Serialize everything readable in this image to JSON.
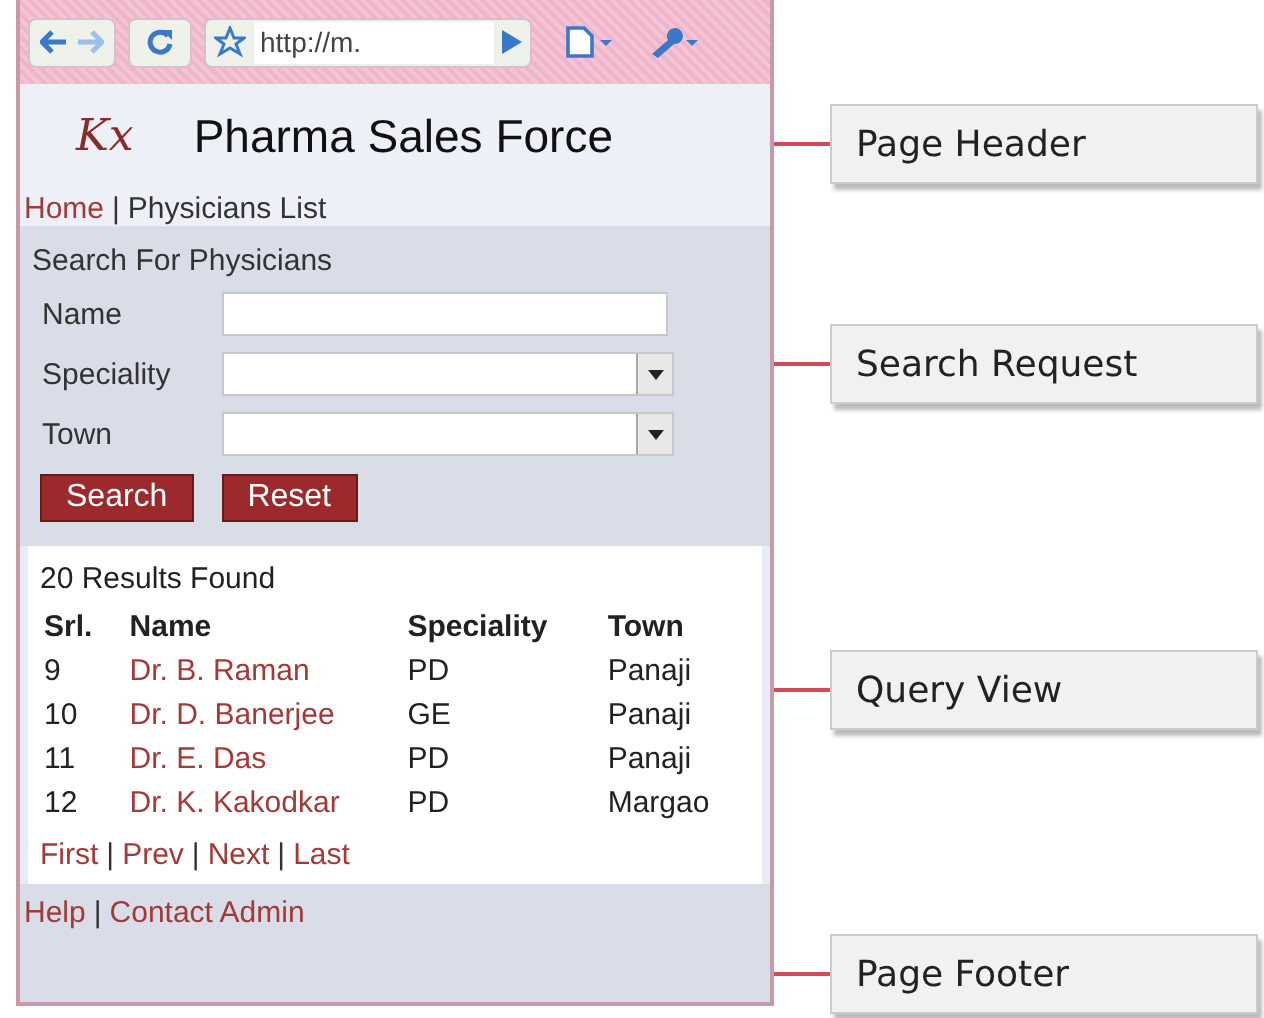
{
  "browser": {
    "address": "http://m."
  },
  "header": {
    "logo": "Kx",
    "title": "Pharma Sales Force"
  },
  "nav": [
    {
      "text": "Home",
      "kind": "link"
    },
    {
      "text": "|",
      "kind": "separator"
    },
    {
      "text": "Physicians List",
      "kind": "current"
    }
  ],
  "search": {
    "title": "Search For Physicians",
    "fields": [
      {
        "label": "Name",
        "kind": "text"
      },
      {
        "label": "Speciality",
        "kind": "select"
      },
      {
        "label": "Town",
        "kind": "select"
      }
    ],
    "buttons": [
      "Search",
      "Reset"
    ]
  },
  "results": {
    "count": "20 Results Found",
    "columns": [
      "Srl.",
      "Name",
      "Speciality",
      "Town"
    ],
    "rows": [
      [
        "9",
        "Dr. B. Raman",
        "PD",
        "Panaji"
      ],
      [
        "10",
        "Dr. D. Banerjee",
        "GE",
        "Panaji"
      ],
      [
        "11",
        "Dr. E. Das",
        "PD",
        "Panaji"
      ],
      [
        "12",
        "Dr. K. Kakodkar",
        "PD",
        "Margao"
      ]
    ],
    "pager": [
      {
        "text": "First",
        "kind": "link"
      },
      {
        "text": "|",
        "kind": "separator"
      },
      {
        "text": "Prev",
        "kind": "link"
      },
      {
        "text": "|",
        "kind": "separator"
      },
      {
        "text": "Next",
        "kind": "link"
      },
      {
        "text": "|",
        "kind": "separator"
      },
      {
        "text": "Last",
        "kind": "link"
      }
    ]
  },
  "footer": [
    {
      "text": "Help",
      "kind": "link"
    },
    {
      "text": "|",
      "kind": "separator"
    },
    {
      "text": "Contact Admin",
      "kind": "link"
    }
  ],
  "callouts": [
    "Page Header",
    "Search Request",
    "Query View",
    "Page Footer"
  ]
}
